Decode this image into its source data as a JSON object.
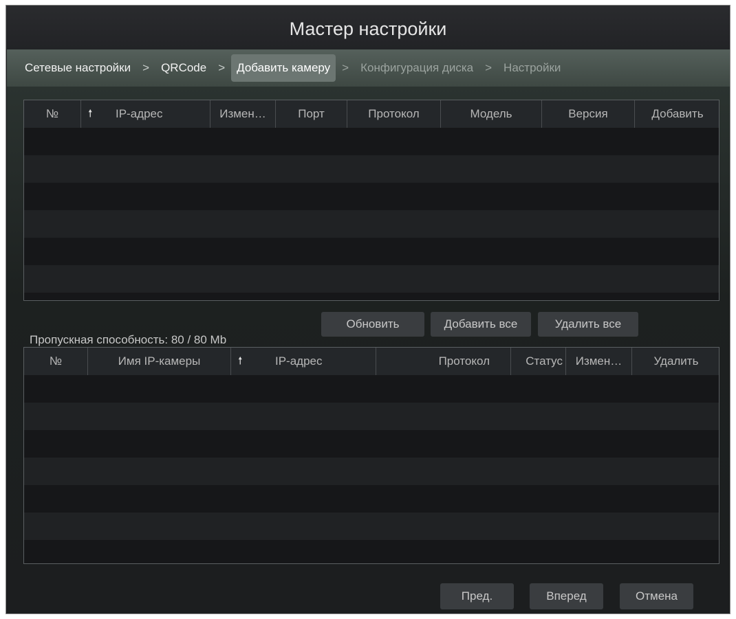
{
  "window": {
    "title": "Мастер настройки"
  },
  "steps": [
    {
      "label": "Сетевые настройки",
      "state": "done"
    },
    {
      "label": "QRCode",
      "state": "done"
    },
    {
      "label": "Добавить камеру",
      "state": "current"
    },
    {
      "label": "Конфигурация диска",
      "state": "future"
    },
    {
      "label": "Настройки",
      "state": "future"
    }
  ],
  "step_separator": ">",
  "search_table": {
    "columns": [
      "№",
      "IP-адрес",
      "Измен…",
      "Порт",
      "Протокол",
      "Модель",
      "Версия",
      "Добавить"
    ],
    "sort_icon": "up-arrow-icon",
    "rows": []
  },
  "actions": {
    "refresh": "Обновить",
    "add_all": "Добавить все",
    "delete_all": "Удалить все"
  },
  "bandwidth": "Пропускная способность: 80 / 80 Mb",
  "added_table": {
    "columns": [
      "№",
      "Имя IP-камеры",
      "IP-адрес",
      "Протокол",
      "Статус",
      "Измен…",
      "Удалить"
    ],
    "sort_icon": "up-arrow-icon",
    "rows": []
  },
  "footer": {
    "prev": "Пред.",
    "next": "Вперед",
    "cancel": "Отмена"
  },
  "colors": {
    "background": "#1b1c1e",
    "step_bar": "#4a5450",
    "current_step": "#6c7672",
    "button": "#3a3d40"
  }
}
